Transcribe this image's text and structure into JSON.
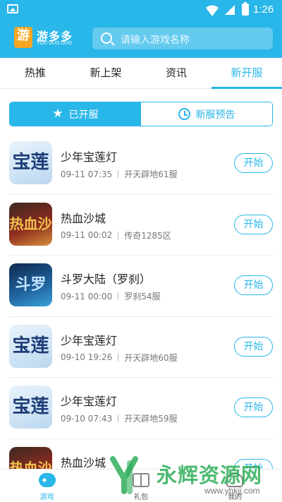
{
  "status_bar": {
    "time": "1:26"
  },
  "header": {
    "logo_glyph": "游",
    "logo_title": "游多多",
    "logo_sub": "YOU DUO DUO",
    "search_placeholder": "请输入游戏名称"
  },
  "tabs": [
    {
      "label": "热推",
      "active": false
    },
    {
      "label": "新上架",
      "active": false
    },
    {
      "label": "资讯",
      "active": false
    },
    {
      "label": "新开服",
      "active": true
    }
  ],
  "segment": {
    "opened_label": "已开服",
    "preview_label": "新服预告"
  },
  "games": [
    {
      "name": "少年宝莲灯",
      "time": "09-11 07:35",
      "server": "开天辟地61服",
      "button": "开始",
      "thumb": "lotus",
      "glyph": "宝莲灯"
    },
    {
      "name": "热血沙城",
      "time": "09-11 00:02",
      "server": "传奇1285区",
      "button": "开始",
      "thumb": "blood",
      "glyph": "热血沙城"
    },
    {
      "name": "斗罗大陆（罗刹）",
      "time": "09-11 00:00",
      "server": "罗刹54服",
      "button": "开始",
      "thumb": "douluo",
      "glyph": "斗罗"
    },
    {
      "name": "少年宝莲灯",
      "time": "09-10 19:26",
      "server": "开天辟地60服",
      "button": "开始",
      "thumb": "lotus",
      "glyph": "宝莲灯"
    },
    {
      "name": "少年宝莲灯",
      "time": "09-10 07:43",
      "server": "开天辟地59服",
      "button": "开始",
      "thumb": "lotus",
      "glyph": "宝莲灯"
    },
    {
      "name": "热血沙城",
      "time": "",
      "server": "",
      "button": "开始",
      "thumb": "blood",
      "glyph": "热血沙城"
    }
  ],
  "bottom_nav": [
    {
      "label": "游戏",
      "icon": "gamepad-icon",
      "active": true
    },
    {
      "label": "礼包",
      "icon": "gift-icon",
      "active": false
    },
    {
      "label": "我的",
      "icon": "user-icon",
      "active": false
    }
  ],
  "watermark": {
    "text": "永辉资源网",
    "url": "www.yhkjj.com"
  },
  "colors": {
    "accent": "#29b6e8",
    "watermark": "#2fae5a"
  }
}
